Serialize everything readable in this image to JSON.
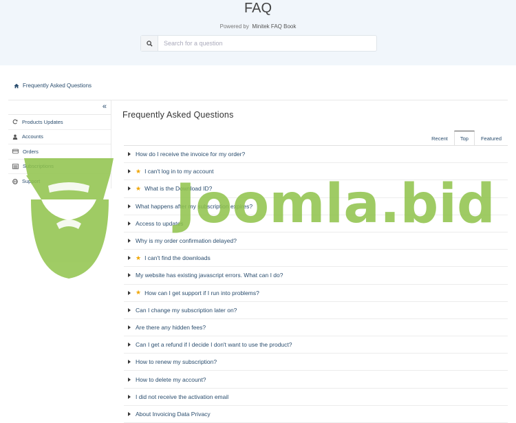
{
  "hero": {
    "title": "FAQ",
    "powered_prefix": "Powered by",
    "powered_brand": "Minitek FAQ Book"
  },
  "search": {
    "placeholder": "Search for a question"
  },
  "breadcrumb": {
    "label": "Frequently Asked Questions"
  },
  "sidebar": {
    "items": [
      {
        "label": "Products Updates",
        "icon": "refresh-icon"
      },
      {
        "label": "Accounts",
        "icon": "user-icon"
      },
      {
        "label": "Orders",
        "icon": "credit-card-icon"
      },
      {
        "label": "Subscriptions",
        "icon": "list-icon"
      },
      {
        "label": "Support",
        "icon": "globe-icon"
      }
    ]
  },
  "main": {
    "title": "Frequently Asked Questions",
    "tabs": [
      {
        "label": "Recent",
        "active": false
      },
      {
        "label": "Top",
        "active": true
      },
      {
        "label": "Featured",
        "active": false
      }
    ],
    "questions": [
      {
        "text": "How do I receive the invoice for my order?",
        "featured": false
      },
      {
        "text": "I can't log in to my account",
        "featured": true
      },
      {
        "text": "What is the Download ID?",
        "featured": true
      },
      {
        "text": "What happens after my subscription expires?",
        "featured": false
      },
      {
        "text": "Access to updates",
        "featured": false
      },
      {
        "text": "Why is my order confirmation delayed?",
        "featured": false
      },
      {
        "text": "I can't find the downloads",
        "featured": true
      },
      {
        "text": "My website has existing javascript errors. What can I do?",
        "featured": false
      },
      {
        "text": "How can I get support if I run into problems?",
        "featured": true
      },
      {
        "text": "Can I change my subscription later on?",
        "featured": false
      },
      {
        "text": "Are there any hidden fees?",
        "featured": false
      },
      {
        "text": "Can I get a refund if I decide I don't want to use the product?",
        "featured": false
      },
      {
        "text": "How to renew my subscription?",
        "featured": false
      },
      {
        "text": "How to delete my account?",
        "featured": false
      },
      {
        "text": "I did not receive the activation email",
        "featured": false
      },
      {
        "text": "About Invoicing Data Privacy",
        "featured": false
      }
    ]
  },
  "watermark": {
    "text": "Joomla.bid",
    "color": "#8fc34a"
  },
  "colors": {
    "hero_bg": "#f1f6fb",
    "link": "#2a4d6e",
    "star": "#f0a500"
  }
}
